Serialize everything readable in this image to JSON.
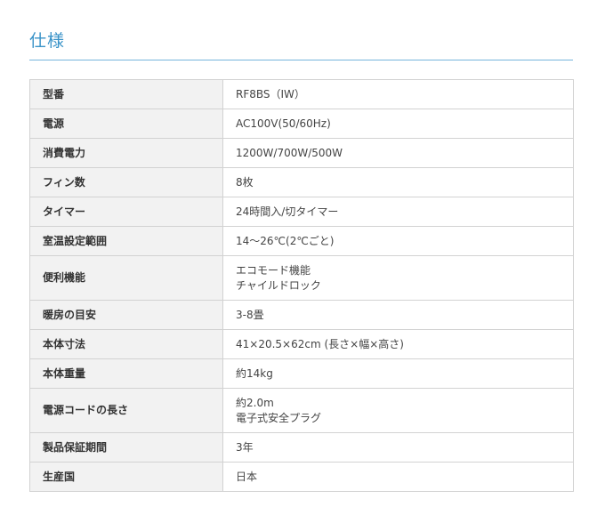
{
  "page": {
    "title": "仕様",
    "accent_color": "#3a93c8"
  },
  "specs": [
    {
      "label": "型番",
      "value": "RF8BS（IW）"
    },
    {
      "label": "電源",
      "value": "AC100V(50/60Hz)"
    },
    {
      "label": "消費電力",
      "value": "1200W/700W/500W"
    },
    {
      "label": "フィン数",
      "value": "8枚"
    },
    {
      "label": "タイマー",
      "value": "24時間入/切タイマー"
    },
    {
      "label": "室温設定範囲",
      "value": "14～26℃(2℃ごと)"
    },
    {
      "label": "便利機能",
      "value": "エコモード機能\nチャイルドロック"
    },
    {
      "label": "暖房の目安",
      "value": "3-8畳"
    },
    {
      "label": "本体寸法",
      "value": "41×20.5×62cm (長さ×幅×高さ)"
    },
    {
      "label": "本体重量",
      "value": "約14kg"
    },
    {
      "label": "電源コードの長さ",
      "value": "約2.0m\n電子式安全プラグ"
    },
    {
      "label": "製品保証期間",
      "value": "3年"
    },
    {
      "label": "生産国",
      "value": "日本"
    }
  ]
}
